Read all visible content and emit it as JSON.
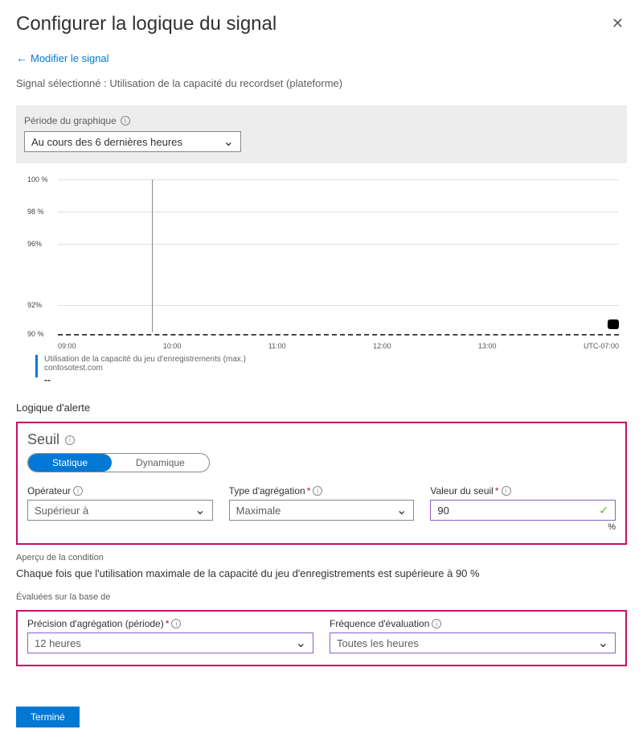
{
  "header": {
    "title": "Configurer la logique du signal"
  },
  "back_link": "Modifier le signal",
  "signal_selected": "Signal sélectionné : Utilisation de la capacité du recordset (plateforme)",
  "chart_period": {
    "label": "Période du graphique",
    "value": "Au cours des 6 dernières heures"
  },
  "chart_data": {
    "type": "line",
    "title": "",
    "xlabel": "",
    "ylabel": "",
    "ylim": [
      90,
      100
    ],
    "y_ticks": [
      "90 %",
      "92%",
      "96%",
      "98 %",
      "100 %"
    ],
    "x_ticks": [
      "09:00",
      "10:00",
      "11:00",
      "12:00",
      "13:00",
      "UTC-07:00"
    ],
    "series": [
      {
        "name": "Utilisation de la capacité du jeu d'enregistrements (max.)",
        "values": []
      }
    ],
    "legend": {
      "series_name": "Utilisation de la capacité du jeu d'enregistrements (max.)",
      "resource": "contosotest.com",
      "value": "--"
    }
  },
  "alert_logic": {
    "section_label": "Logique d'alerte",
    "threshold_label": "Seuil",
    "toggle": {
      "static": "Statique",
      "dynamic": "Dynamique"
    },
    "operator": {
      "label": "Opérateur",
      "value": "Supérieur à"
    },
    "aggregation_type": {
      "label": "Type d'agrégation",
      "value": "Maximale"
    },
    "threshold_value": {
      "label": "Valeur du seuil",
      "value": "90",
      "unit": "%"
    }
  },
  "condition_preview": {
    "label": "Aperçu de la condition",
    "text": "Chaque fois que l'utilisation maximale de la capacité du jeu d'enregistrements est supérieure à 90 %"
  },
  "evaluated": {
    "label": "Évaluées sur la base de",
    "granularity": {
      "label": "Précision d'agrégation (période)",
      "value": "12 heures"
    },
    "frequency": {
      "label": "Fréquence d'évaluation",
      "value": "Toutes les heures"
    }
  },
  "footer": {
    "done": "Terminé"
  }
}
